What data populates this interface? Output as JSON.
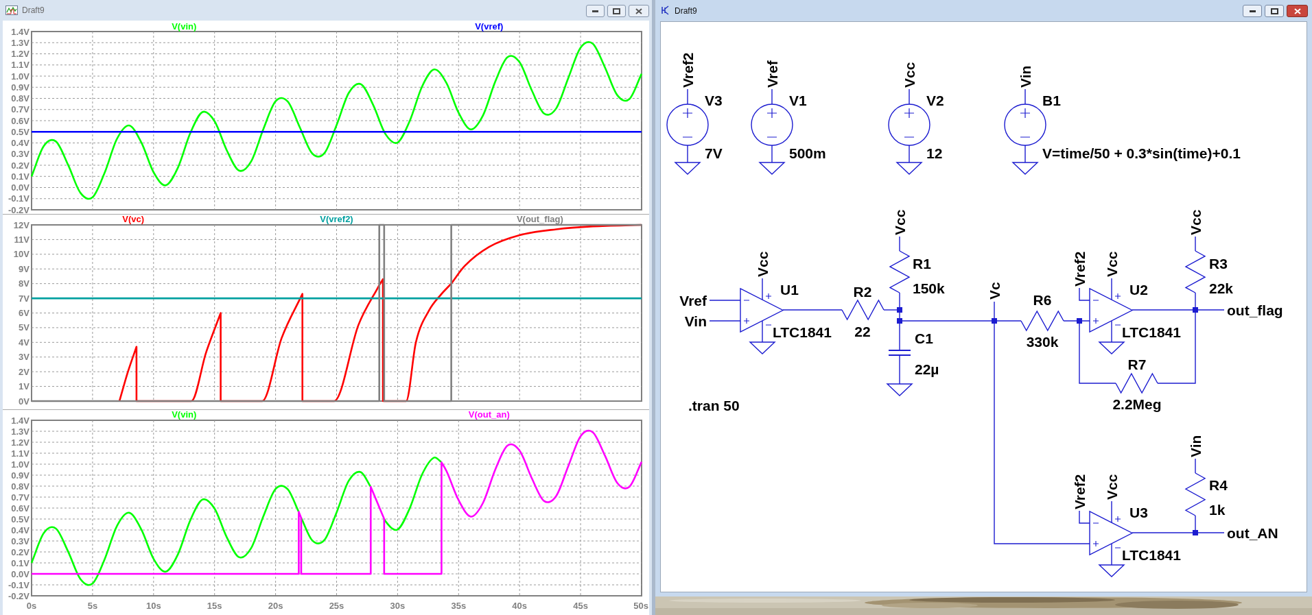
{
  "plot_window": {
    "title": "Draft9",
    "panes": [
      {
        "chart_data": {
          "type": "line",
          "x": [
            0,
            1,
            2,
            3,
            4,
            5,
            6,
            7,
            8,
            9,
            10,
            11,
            12,
            13,
            14,
            15,
            16,
            17,
            18,
            19,
            20,
            21,
            22,
            23,
            24,
            25,
            26,
            27,
            28,
            29,
            30,
            31,
            32,
            33,
            34,
            35,
            36,
            37,
            38,
            39,
            40,
            41,
            42,
            43,
            44,
            45,
            46,
            47,
            48,
            49,
            50
          ],
          "xlim": [
            0,
            50
          ],
          "ylim": [
            -0.2,
            1.4
          ],
          "grid": true,
          "yticks": [
            {
              "value": 1.4,
              "label": "1.4V"
            },
            {
              "value": 1.3,
              "label": "1.3V"
            },
            {
              "value": 1.2,
              "label": "1.2V"
            },
            {
              "value": 1.1,
              "label": "1.1V"
            },
            {
              "value": 1.0,
              "label": "1.0V"
            },
            {
              "value": 0.9,
              "label": "0.9V"
            },
            {
              "value": 0.8,
              "label": "0.8V"
            },
            {
              "value": 0.7,
              "label": "0.7V"
            },
            {
              "value": 0.6,
              "label": "0.6V"
            },
            {
              "value": 0.5,
              "label": "0.5V"
            },
            {
              "value": 0.4,
              "label": "0.4V"
            },
            {
              "value": 0.3,
              "label": "0.3V"
            },
            {
              "value": 0.2,
              "label": "0.2V"
            },
            {
              "value": 0.1,
              "label": "0.1V"
            },
            {
              "value": 0.0,
              "label": "0.0V"
            },
            {
              "value": -0.1,
              "label": "-0.1V"
            },
            {
              "value": -0.2,
              "label": "-0.2V"
            }
          ],
          "series": [
            {
              "name": "V(vin)",
              "color": "#00ff00",
              "values": [
                0.1,
                0.372,
                0.413,
                0.202,
                -0.047,
                -0.088,
                0.136,
                0.437,
                0.557,
                0.404,
                0.137,
                0.02,
                0.179,
                0.486,
                0.677,
                0.595,
                0.334,
                0.152,
                0.235,
                0.525,
                0.774,
                0.771,
                0.537,
                0.306,
                0.308,
                0.56,
                0.849,
                0.927,
                0.741,
                0.481,
                0.404,
                0.599,
                0.905,
                1.06,
                0.939,
                0.672,
                0.522,
                0.647,
                0.949,
                1.169,
                1.124,
                0.872,
                0.665,
                0.71,
                0.985,
                1.255,
                1.291,
                1.077,
                0.83,
                0.794,
                1.021
              ]
            },
            {
              "name": "V(vref)",
              "color": "#0000ff",
              "values": [
                0.5,
                0.5,
                0.5,
                0.5,
                0.5,
                0.5,
                0.5,
                0.5,
                0.5,
                0.5,
                0.5,
                0.5,
                0.5,
                0.5,
                0.5,
                0.5,
                0.5,
                0.5,
                0.5,
                0.5,
                0.5,
                0.5,
                0.5,
                0.5,
                0.5,
                0.5,
                0.5,
                0.5,
                0.5,
                0.5,
                0.5,
                0.5,
                0.5,
                0.5,
                0.5,
                0.5,
                0.5,
                0.5,
                0.5,
                0.5,
                0.5,
                0.5,
                0.5,
                0.5,
                0.5,
                0.5,
                0.5,
                0.5,
                0.5,
                0.5,
                0.5
              ]
            }
          ]
        }
      },
      {
        "chart_data": {
          "type": "line",
          "x": [
            0,
            7.2,
            7.9,
            8.6,
            8.6,
            13.1,
            14.3,
            15.5,
            15.5,
            18.9,
            20.5,
            22.2,
            22.2,
            24.8,
            26.8,
            28.5,
            28.5,
            28.8,
            28.8,
            28.9,
            28.9,
            30.7,
            31.5,
            32.6,
            33.5,
            34.4,
            34.4,
            35.5,
            37.5,
            40,
            43,
            46,
            50
          ],
          "xlim": [
            0,
            50
          ],
          "ylim": [
            0,
            12
          ],
          "grid": true,
          "yticks": [
            {
              "value": 12,
              "label": "12V"
            },
            {
              "value": 11,
              "label": "11V"
            },
            {
              "value": 10,
              "label": "10V"
            },
            {
              "value": 9,
              "label": "9V"
            },
            {
              "value": 8,
              "label": "8V"
            },
            {
              "value": 7,
              "label": "7V"
            },
            {
              "value": 6,
              "label": "6V"
            },
            {
              "value": 5,
              "label": "5V"
            },
            {
              "value": 4,
              "label": "4V"
            },
            {
              "value": 3,
              "label": "3V"
            },
            {
              "value": 2,
              "label": "2V"
            },
            {
              "value": 1,
              "label": "1V"
            },
            {
              "value": 0,
              "label": "0V"
            }
          ],
          "series": [
            {
              "name": "V(vc)",
              "color": "#ff0000",
              "values": [
                null,
                0,
                2.0,
                3.7,
                0,
                0,
                3.3,
                6.0,
                0,
                0,
                4.3,
                7.3,
                0,
                0,
                5.2,
                7.9,
                7.9,
                8.3,
                0,
                0,
                0,
                0,
                4.0,
                6.2,
                7.2,
                8.0,
                8.0,
                9.2,
                10.5,
                11.3,
                11.7,
                11.9,
                12.0
              ]
            },
            {
              "name": "V(vref2)",
              "color": "#00a0a0",
              "values": [
                7,
                7,
                7,
                7,
                7,
                7,
                7,
                7,
                7,
                7,
                7,
                7,
                7,
                7,
                7,
                7,
                7,
                7,
                7,
                7,
                7,
                7,
                7,
                7,
                7,
                7,
                7,
                7,
                7,
                7,
                7,
                7,
                7
              ]
            },
            {
              "name": "V(out_flag)",
              "color": "#808080",
              "values": [
                0,
                0,
                0,
                0,
                0,
                0,
                0,
                0,
                0,
                0,
                0,
                0,
                0,
                0,
                0,
                0,
                12,
                12,
                12,
                12,
                0,
                0,
                0,
                0,
                0,
                0,
                12,
                12,
                12,
                12,
                12,
                12,
                12
              ]
            }
          ]
        }
      },
      {
        "chart_data": {
          "type": "line",
          "x": [
            0,
            1,
            2,
            3,
            4,
            5,
            6,
            7,
            8,
            9,
            10,
            11,
            12,
            13,
            14,
            15,
            16,
            17,
            18,
            19,
            20,
            21,
            21.9,
            21.9,
            22,
            22.1,
            22.1,
            23,
            24,
            25,
            26,
            27,
            27.8,
            27.8,
            28,
            28.9,
            28.9,
            29,
            30,
            31,
            32,
            33,
            33.6,
            33.6,
            34,
            35,
            36,
            37,
            38,
            39,
            40,
            41,
            42,
            43,
            44,
            45,
            46,
            47,
            48,
            49,
            50
          ],
          "xlim": [
            0,
            50
          ],
          "ylim": [
            -0.2,
            1.4
          ],
          "grid": true,
          "xticks": [
            {
              "value": 0,
              "label": "0s"
            },
            {
              "value": 5,
              "label": "5s"
            },
            {
              "value": 10,
              "label": "10s"
            },
            {
              "value": 15,
              "label": "15s"
            },
            {
              "value": 20,
              "label": "20s"
            },
            {
              "value": 25,
              "label": "25s"
            },
            {
              "value": 30,
              "label": "30s"
            },
            {
              "value": 35,
              "label": "35s"
            },
            {
              "value": 40,
              "label": "40s"
            },
            {
              "value": 45,
              "label": "45s"
            },
            {
              "value": 50,
              "label": "50s"
            }
          ],
          "yticks": [
            {
              "value": 1.4,
              "label": "1.4V"
            },
            {
              "value": 1.3,
              "label": "1.3V"
            },
            {
              "value": 1.2,
              "label": "1.2V"
            },
            {
              "value": 1.1,
              "label": "1.1V"
            },
            {
              "value": 1.0,
              "label": "1.0V"
            },
            {
              "value": 0.9,
              "label": "0.9V"
            },
            {
              "value": 0.8,
              "label": "0.8V"
            },
            {
              "value": 0.7,
              "label": "0.7V"
            },
            {
              "value": 0.6,
              "label": "0.6V"
            },
            {
              "value": 0.5,
              "label": "0.5V"
            },
            {
              "value": 0.4,
              "label": "0.4V"
            },
            {
              "value": 0.3,
              "label": "0.3V"
            },
            {
              "value": 0.2,
              "label": "0.2V"
            },
            {
              "value": 0.1,
              "label": "0.1V"
            },
            {
              "value": 0.0,
              "label": "0.0V"
            },
            {
              "value": -0.1,
              "label": "-0.1V"
            },
            {
              "value": -0.2,
              "label": "-0.2V"
            }
          ],
          "series": [
            {
              "name": "V(vin)",
              "color": "#00ff00",
              "values": [
                0.1,
                0.372,
                0.413,
                0.202,
                -0.047,
                -0.088,
                0.136,
                0.437,
                0.557,
                0.404,
                0.137,
                0.02,
                0.179,
                0.486,
                0.677,
                0.595,
                0.334,
                0.152,
                0.235,
                0.525,
                0.774,
                0.771,
                0.565,
                0.565,
                null,
                0.51,
                0.51,
                0.306,
                0.308,
                0.56,
                0.849,
                0.927,
                0.793,
                0.793,
                null,
                0.501,
                0.501,
                0.481,
                0.404,
                0.599,
                0.905,
                1.06,
                1.017,
                1.017,
                null,
                null,
                null,
                null,
                null,
                null,
                null,
                null,
                null,
                null,
                null,
                null,
                null,
                null,
                null,
                null,
                null
              ]
            },
            {
              "name": "V(out_an)",
              "color": "#ff00ff",
              "values": [
                0,
                0,
                0,
                0,
                0,
                0,
                0,
                0,
                0,
                0,
                0,
                0,
                0,
                0,
                0,
                0,
                0,
                0,
                0,
                0,
                0,
                0,
                0,
                0.565,
                0.537,
                0.51,
                0,
                0,
                0,
                0,
                0,
                0,
                0,
                0.793,
                0.741,
                0.501,
                0,
                0,
                0,
                0,
                0,
                0,
                0,
                1.017,
                0.939,
                0.672,
                0.522,
                0.647,
                0.949,
                1.169,
                1.124,
                0.872,
                0.665,
                0.71,
                0.985,
                1.255,
                1.291,
                1.077,
                0.83,
                0.794,
                1.021
              ]
            }
          ]
        }
      }
    ]
  },
  "schematic_window": {
    "title": "Draft9",
    "schematic": {
      "sources": [
        {
          "net": "Vref2",
          "name": "V3",
          "value": "7V"
        },
        {
          "net": "Vref",
          "name": "V1",
          "value": "500m"
        },
        {
          "net": "Vcc",
          "name": "V2",
          "value": "12"
        },
        {
          "net": "Vin",
          "name": "B1",
          "value": "V=time/50 + 0.3*sin(time)+0.1"
        }
      ],
      "comparators": [
        {
          "name": "U1",
          "model": "LTC1841",
          "supply": "Vcc",
          "inputs": [
            "Vref",
            "Vin"
          ]
        },
        {
          "name": "U2",
          "model": "LTC1841",
          "supply": "Vcc",
          "reference": "Vref2"
        },
        {
          "name": "U3",
          "model": "LTC1841",
          "supply": "Vcc",
          "reference": "Vref2"
        }
      ],
      "resistors": [
        {
          "name": "R1",
          "value": "150k",
          "net": "Vcc"
        },
        {
          "name": "R2",
          "value": "22"
        },
        {
          "name": "R3",
          "value": "22k",
          "net": "Vcc"
        },
        {
          "name": "R6",
          "value": "330k"
        },
        {
          "name": "R7",
          "value": "2.2Meg"
        },
        {
          "name": "R4",
          "value": "1k",
          "net": "Vin"
        }
      ],
      "capacitors": [
        {
          "name": "C1",
          "value": "22µ"
        }
      ],
      "node_labels": [
        "Vc",
        "out_flag",
        "out_AN"
      ],
      "directive": ".tran 50"
    }
  }
}
